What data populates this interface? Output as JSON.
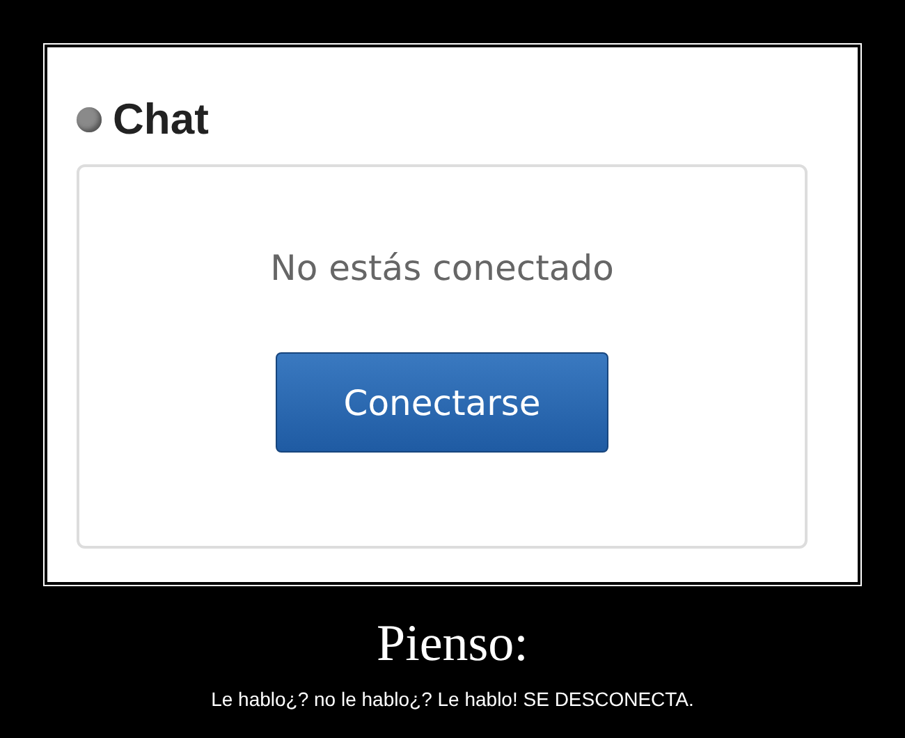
{
  "panel": {
    "title": "Chat",
    "connected": false,
    "message": "No estás conectado",
    "button": "Conectarse"
  },
  "caption": {
    "title": "Pienso:",
    "text": "Le hablo¿? no le hablo¿? Le hablo! SE DESCONECTA."
  }
}
